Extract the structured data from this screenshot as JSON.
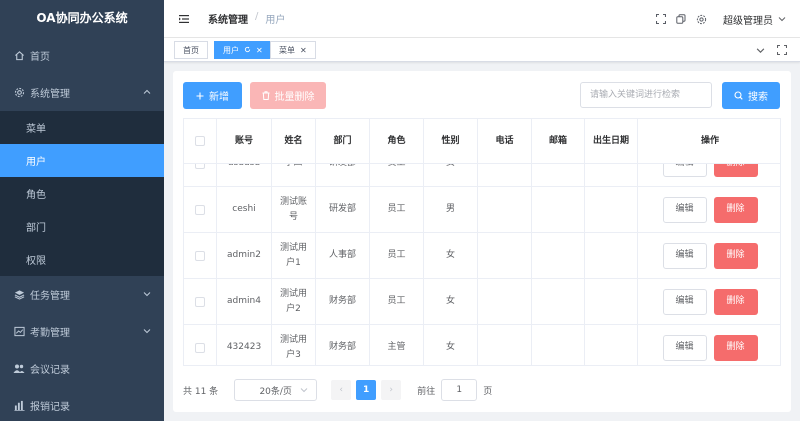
{
  "app": {
    "title": "OA协同办公系统"
  },
  "sidebar": {
    "items": [
      {
        "label": "首页",
        "icon": "home-icon"
      },
      {
        "label": "系统管理",
        "icon": "gear-icon",
        "expanded": true
      },
      {
        "label": "任务管理",
        "icon": "layers-icon"
      },
      {
        "label": "考勤管理",
        "icon": "chart-window-icon"
      },
      {
        "label": "会议记录",
        "icon": "people-icon"
      },
      {
        "label": "报销记录",
        "icon": "bar-chart-icon"
      }
    ],
    "system_sub": [
      {
        "label": "菜单"
      },
      {
        "label": "用户",
        "active": true
      },
      {
        "label": "角色"
      },
      {
        "label": "部门"
      },
      {
        "label": "权限"
      }
    ]
  },
  "navbar": {
    "breadcrumb": [
      "系统管理",
      "用户"
    ],
    "user": "超级管理员"
  },
  "tags": {
    "items": [
      "首页",
      "用户",
      "菜单"
    ]
  },
  "toolbar": {
    "add_label": "新增",
    "batch_delete_label": "批量删除",
    "search_placeholder": "请输入关键词进行检索",
    "search_label": "搜索"
  },
  "table": {
    "columns": [
      "账号",
      "姓名",
      "部门",
      "角色",
      "性别",
      "电话",
      "邮箱",
      "出生日期",
      "操作"
    ],
    "rows": [
      {
        "account": "dsddsd",
        "name": "李四",
        "dept": "研发部",
        "role": "员工",
        "gender": "女",
        "phone": "",
        "email": "",
        "birth": ""
      },
      {
        "account": "ceshi",
        "name": "测试账号",
        "dept": "研发部",
        "role": "员工",
        "gender": "男",
        "phone": "",
        "email": "",
        "birth": ""
      },
      {
        "account": "admin2",
        "name": "测试用户1",
        "dept": "人事部",
        "role": "员工",
        "gender": "女",
        "phone": "",
        "email": "",
        "birth": ""
      },
      {
        "account": "admin4",
        "name": "测试用户2",
        "dept": "财务部",
        "role": "员工",
        "gender": "女",
        "phone": "",
        "email": "",
        "birth": ""
      },
      {
        "account": "432423",
        "name": "测试用户3",
        "dept": "财务部",
        "role": "主管",
        "gender": "女",
        "phone": "",
        "email": "",
        "birth": ""
      }
    ],
    "edit_label": "编辑",
    "delete_label": "删除"
  },
  "pagination": {
    "total_text": "共 11 条",
    "page_size": "20条/页",
    "current_page": "1",
    "goto_label": "前往",
    "goto_value": "1",
    "page_unit": "页"
  },
  "colors": {
    "primary": "#409eff",
    "danger": "#f56c6c",
    "sidebar_bg": "#304156"
  }
}
